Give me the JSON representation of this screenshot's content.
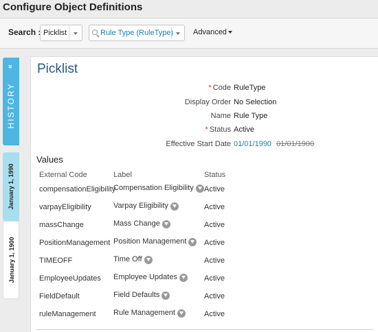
{
  "page": {
    "title": "Configure Object Definitions"
  },
  "search": {
    "label": "Search :",
    "type_value": "Picklist",
    "object_value": "Rule Type (RuleType)",
    "advanced_label": "Advanced"
  },
  "sidebar": {
    "history_label": "HISTORY",
    "history_chevron": "«",
    "dates": [
      "January 1, 1990",
      "January 1, 1900"
    ]
  },
  "detail": {
    "title": "Picklist",
    "fields": [
      {
        "label": "Code",
        "required": true,
        "value": "RuleType"
      },
      {
        "label": "Display Order",
        "required": false,
        "value": "No Selection"
      },
      {
        "label": "Name",
        "required": false,
        "value": "Rule Type"
      },
      {
        "label": "Status",
        "required": true,
        "value": "Active"
      },
      {
        "label": "Effective Start Date",
        "required": false,
        "value": "01/01/1990",
        "old_value": "01/01/1900"
      }
    ],
    "required_marker": "*"
  },
  "values": {
    "title": "Values",
    "columns": [
      "External Code",
      "Label",
      "Status"
    ],
    "rows": [
      {
        "code": "compensationEligibility",
        "label": "Compensation Eligibility",
        "status": "Active"
      },
      {
        "code": "varpayEligibility",
        "label": "Varpay Eligibility",
        "status": "Active"
      },
      {
        "code": "massChange",
        "label": "Mass Change",
        "status": "Active"
      },
      {
        "code": "PositionManagement",
        "label": "Position Management",
        "status": "Active"
      },
      {
        "code": "TIMEOFF",
        "label": "Time Off",
        "status": "Active"
      },
      {
        "code": "EmployeeUpdates",
        "label": "Employee Updates",
        "status": "Active"
      },
      {
        "code": "FieldDefault",
        "label": "Field Defaults",
        "status": "Active"
      },
      {
        "code": "ruleManagement",
        "label": "Rule Management",
        "status": "Active"
      }
    ]
  },
  "icons": {
    "info_icon": "translation-info-icon",
    "search_icon": "search-icon"
  },
  "colors": {
    "accent": "#1a7fb3",
    "title_blue": "#225a8a",
    "history_tab": "#4db6e3",
    "date_tab_active": "#a7dfee"
  }
}
